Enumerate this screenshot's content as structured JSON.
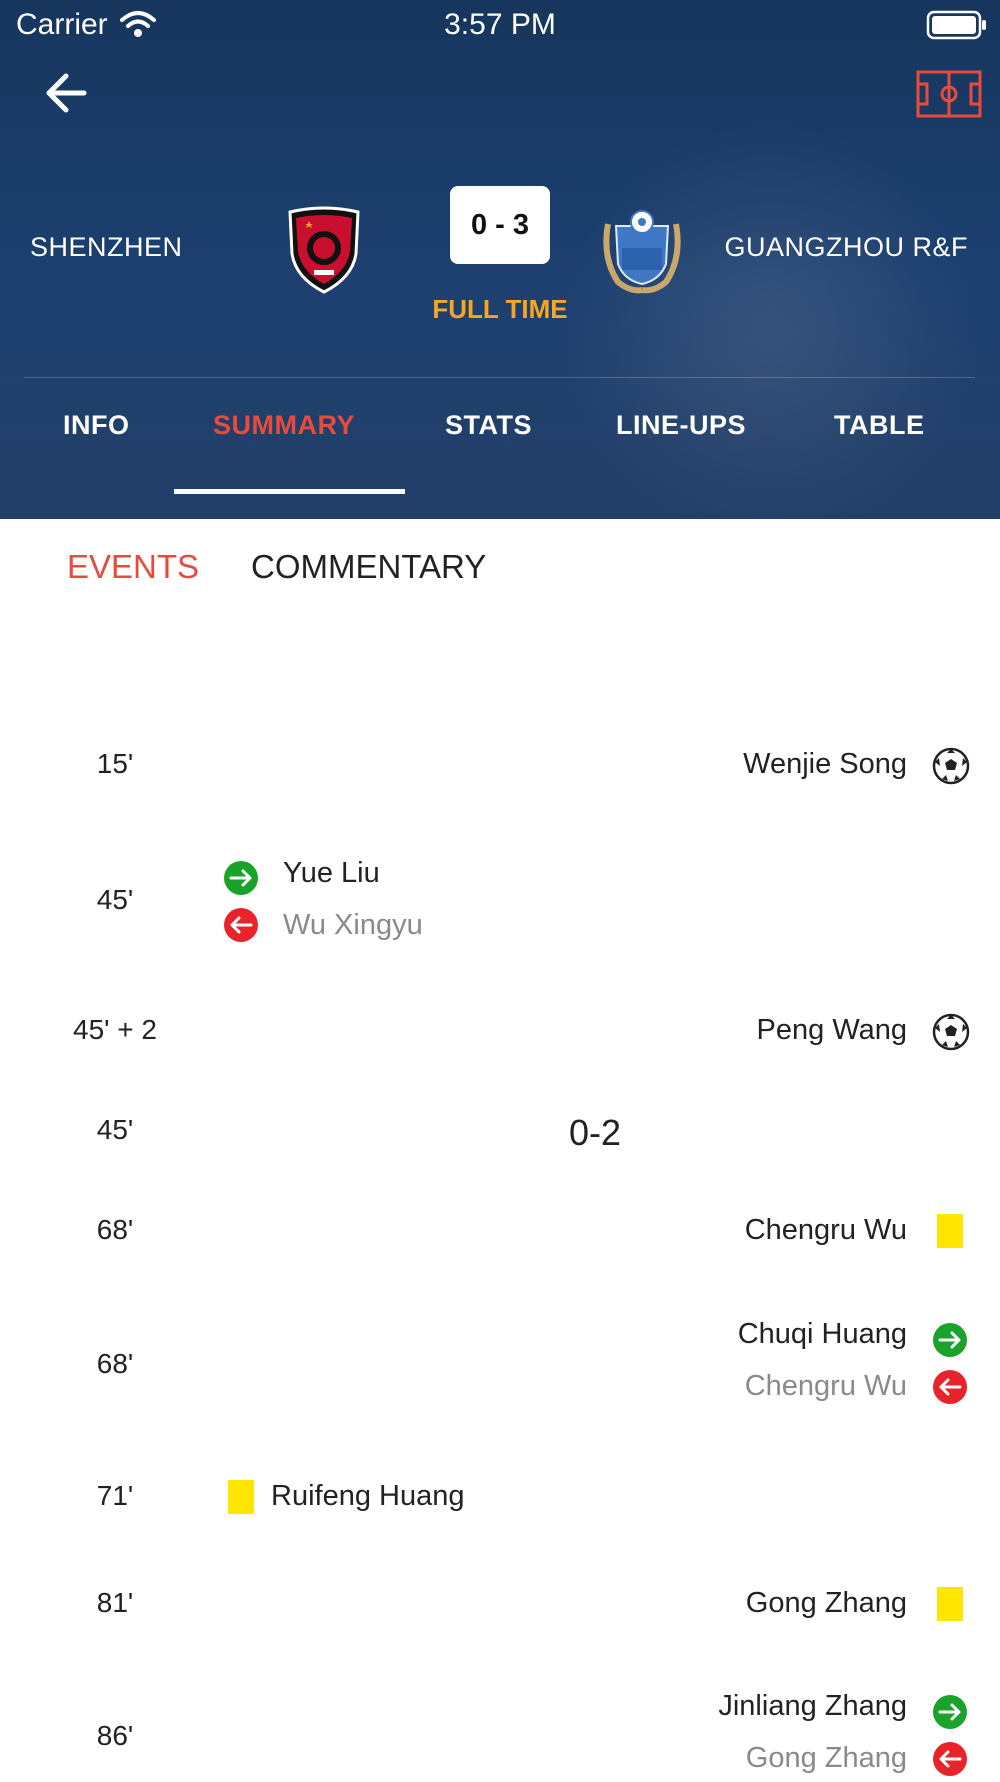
{
  "status_bar": {
    "carrier": "Carrier",
    "time": "3:57 PM"
  },
  "match": {
    "home_team": "SHENZHEN",
    "away_team": "GUANGZHOU R&F",
    "score": "0 - 3",
    "status": "FULL TIME"
  },
  "tabs": [
    {
      "label": "INFO",
      "active": false
    },
    {
      "label": "SUMMARY",
      "active": true
    },
    {
      "label": "STATS",
      "active": false
    },
    {
      "label": "LINE-UPS",
      "active": false
    },
    {
      "label": "TABLE",
      "active": false
    }
  ],
  "subtabs": [
    {
      "label": "EVENTS",
      "active": true
    },
    {
      "label": "COMMENTARY",
      "active": false
    }
  ],
  "events": [
    {
      "minute": "15'",
      "side": "away",
      "type": "goal",
      "player": "Wenjie Song"
    },
    {
      "minute": "45'",
      "side": "home",
      "type": "substitution",
      "player_in": "Yue Liu",
      "player_out": "Wu Xingyu"
    },
    {
      "minute": "45' + 2",
      "side": "away",
      "type": "goal",
      "player": "Peng Wang"
    },
    {
      "minute": "45'",
      "side": "center",
      "type": "score",
      "score": "0-2"
    },
    {
      "minute": "68'",
      "side": "away",
      "type": "yellow-card",
      "player": "Chengru Wu"
    },
    {
      "minute": "68'",
      "side": "away",
      "type": "substitution",
      "player_in": "Chuqi Huang",
      "player_out": "Chengru Wu"
    },
    {
      "minute": "71'",
      "side": "home",
      "type": "yellow-card",
      "player": "Ruifeng Huang"
    },
    {
      "minute": "81'",
      "side": "away",
      "type": "yellow-card",
      "player": "Gong Zhang"
    },
    {
      "minute": "86'",
      "side": "away",
      "type": "substitution",
      "player_in": "Jinliang Zhang",
      "player_out": "Gong Zhang"
    }
  ],
  "colors": {
    "header_bg": "#1d4070",
    "accent_red": "#e84a3c",
    "full_time_orange": "#f5a623",
    "sub_in_green": "#1aa32a",
    "sub_out_red": "#e8232a",
    "yellow_card": "#ffe600"
  }
}
